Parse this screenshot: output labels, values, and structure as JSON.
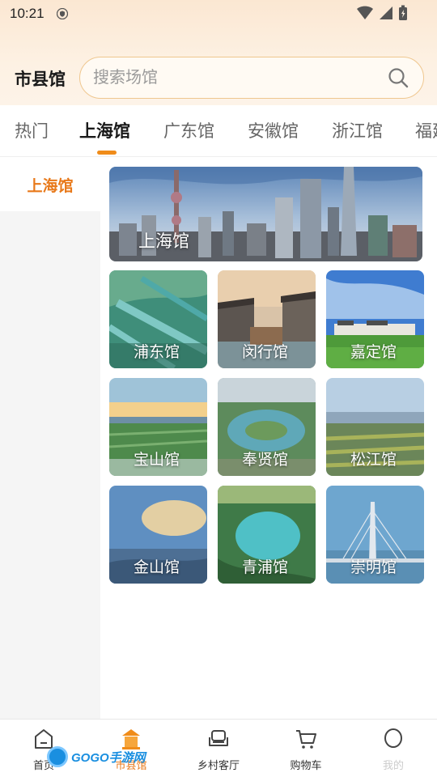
{
  "status": {
    "time": "10:21"
  },
  "header": {
    "title": "市县馆",
    "search_placeholder": "搜索场馆"
  },
  "tabs": [
    {
      "label": "热门"
    },
    {
      "label": "上海馆",
      "active": true
    },
    {
      "label": "广东馆"
    },
    {
      "label": "安徽馆"
    },
    {
      "label": "浙江馆"
    },
    {
      "label": "福建"
    }
  ],
  "sidebar": {
    "items": [
      {
        "label": "上海馆",
        "active": true
      }
    ]
  },
  "grid": {
    "banner": {
      "label": "上海馆"
    },
    "cards": [
      {
        "label": "浦东馆"
      },
      {
        "label": "闵行馆"
      },
      {
        "label": "嘉定馆"
      },
      {
        "label": "宝山馆"
      },
      {
        "label": "奉贤馆"
      },
      {
        "label": "松江馆"
      },
      {
        "label": "金山馆"
      },
      {
        "label": "青浦馆"
      },
      {
        "label": "崇明馆"
      }
    ]
  },
  "bottom_nav": [
    {
      "label": "首页",
      "icon": "home-icon"
    },
    {
      "label": "市县馆",
      "icon": "pavilion-icon",
      "active": true
    },
    {
      "label": "乡村客厅",
      "icon": "sofa-icon"
    },
    {
      "label": "购物车",
      "icon": "cart-icon"
    },
    {
      "label": "我的",
      "icon": "profile-icon"
    }
  ],
  "watermark": {
    "text": "GOGO手游网"
  },
  "colors": {
    "accent": "#e8791a",
    "search_border": "#efc78f"
  }
}
